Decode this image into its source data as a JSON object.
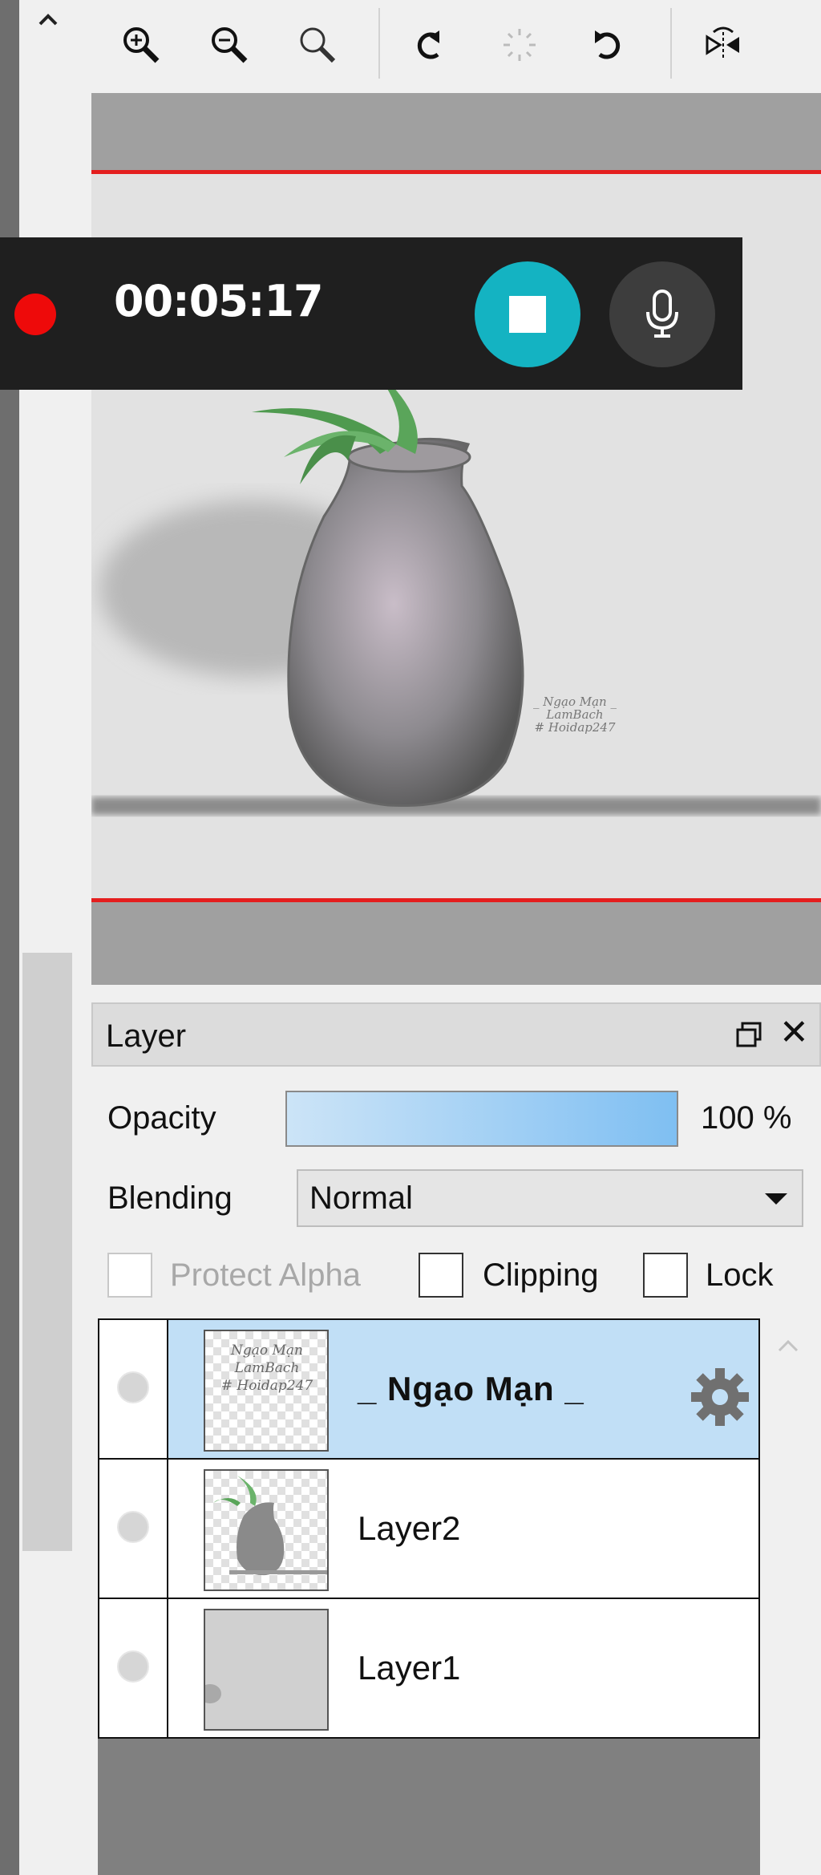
{
  "toolbar": {
    "buttons": [
      {
        "icon": "zoom-in-icon"
      },
      {
        "icon": "zoom-out-icon"
      },
      {
        "icon": "zoom-reset-icon"
      },
      {
        "icon": "rotate-left-icon"
      },
      {
        "icon": "loading-spinner-icon"
      },
      {
        "icon": "rotate-right-icon"
      },
      {
        "icon": "flip-horizontal-icon"
      }
    ]
  },
  "canvas": {
    "watermark": [
      "_ Ngạo Mạn _",
      "LamBach",
      "# Hoidap247"
    ]
  },
  "recorder": {
    "elapsed_time": "00:05:17",
    "colors": {
      "record": "#ee0a0a",
      "stop": "#14b3c2",
      "mic": "#3d3d3d"
    }
  },
  "layer_panel": {
    "title": "Layer",
    "opacity_label": "Opacity",
    "opacity_value": "100 %",
    "opacity_fraction": 1.0,
    "blending_label": "Blending",
    "blending_value": "Normal",
    "protect_alpha_label": "Protect Alpha",
    "clipping_label": "Clipping",
    "lock_label": "Lock",
    "protect_alpha_checked": false,
    "clipping_checked": false,
    "lock_checked": false,
    "layers": [
      {
        "name": "_ Ngạo Mạn _",
        "selected": true,
        "thumb_text": [
          "Ngạo Mạn",
          "LamBach",
          "# Hoidap247"
        ]
      },
      {
        "name": "Layer2",
        "selected": false
      },
      {
        "name": "Layer1",
        "selected": false
      }
    ]
  }
}
